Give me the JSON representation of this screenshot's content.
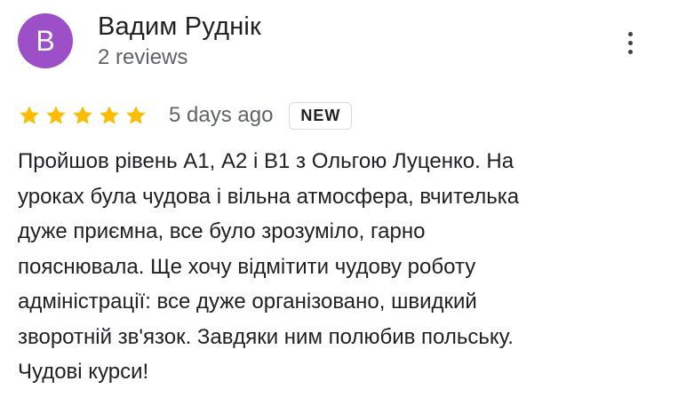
{
  "author": {
    "initial": "В",
    "name": "Вадим Руднік",
    "meta": "2 reviews",
    "avatar_color": "#9c4fc7"
  },
  "menu": {
    "icon": "more-vert-icon"
  },
  "rating": {
    "stars": 5,
    "max_stars": 5,
    "star_color": "#fbbc04",
    "timestamp": "5 days ago",
    "badge": "NEW"
  },
  "review": {
    "lines": [
      "Пройшов рівень А1, А2 і В1 з Ольгою Луценко. На",
      "уроках була чудова і вільна атмосфера, вчителька",
      "дуже приємна, все було зрозуміло, гарно",
      "пояснювала. Ще хочу відмітити чудову роботу",
      "адміністрації: все дуже організовано, швидкий",
      "зворотній зв'язок. Завдяки ним полюбив польську.",
      "Чудові курси!"
    ]
  }
}
